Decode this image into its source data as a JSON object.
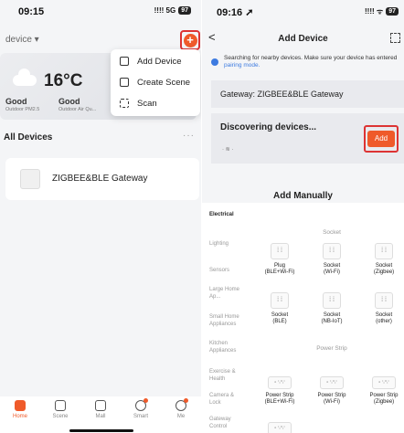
{
  "left": {
    "status": {
      "time": "09:15",
      "signal": "!!!! 5G",
      "battery": "97"
    },
    "home_name": "device ▾",
    "weather": {
      "temp": "16°C",
      "items": [
        {
          "label": "Good",
          "sub": "Outdoor PM2.5"
        },
        {
          "label": "Good",
          "sub": "Outdoor Air Qu..."
        }
      ]
    },
    "menu": [
      {
        "label": "Add Device",
        "icon": "add-device-icon"
      },
      {
        "label": "Create Scene",
        "icon": "create-scene-icon"
      },
      {
        "label": "Scan",
        "icon": "scan-icon"
      }
    ],
    "all_devices": "All Devices",
    "more": "···",
    "device_name": "ZIGBEE&BLE Gateway",
    "tabs": [
      {
        "label": "Home",
        "active": true
      },
      {
        "label": "Scene"
      },
      {
        "label": "Mall"
      },
      {
        "label": "Smart",
        "badge": true
      },
      {
        "label": "Me",
        "badge": true
      }
    ]
  },
  "right": {
    "status": {
      "time": "09:16 ➚",
      "signal": "!!!! ᯤ",
      "battery": "97"
    },
    "back": "<",
    "title": "Add Device",
    "search_text": "Searching for nearby devices. Make sure your device has entered ",
    "search_link": "pairing mode.",
    "gateway": "Gateway: ZIGBEE&BLE Gateway",
    "discover_title": "Discovering devices...",
    "discover_small": "· ≋ ·",
    "add_label": "Add",
    "manual_title": "Add Manually",
    "categories": [
      "Electrical",
      "Lighting",
      "Sensors",
      "Large Home Ap...",
      "Small Home Appliances",
      "Kitchen Appliances",
      "Exercise & Health",
      "Camera & Lock",
      "Gateway Control"
    ],
    "section_socket": "Socket",
    "section_strip": "Power Strip",
    "socket_row1": [
      {
        "name": "Plug\n(BLE+Wi-Fi)"
      },
      {
        "name": "Socket\n(Wi-Fi)"
      },
      {
        "name": "Socket\n(Zigbee)"
      }
    ],
    "socket_row2": [
      {
        "name": "Socket\n(BLE)"
      },
      {
        "name": "Socket\n(NB-IoT)"
      },
      {
        "name": "Socket\n(other)"
      }
    ],
    "strip_row": [
      {
        "name": "Power Strip\n(BLE+Wi-Fi)"
      },
      {
        "name": "Power Strip\n(Wi-Fi)"
      },
      {
        "name": "Power Strip\n(Zigbee)"
      }
    ],
    "socket_glyph": "⁞ ⁞",
    "strip_glyph": "▫ ∵∵",
    "icon_colors": {
      "accent": "#ef5a2a",
      "link": "#3d7be0",
      "highlight": "#dd3333"
    }
  }
}
